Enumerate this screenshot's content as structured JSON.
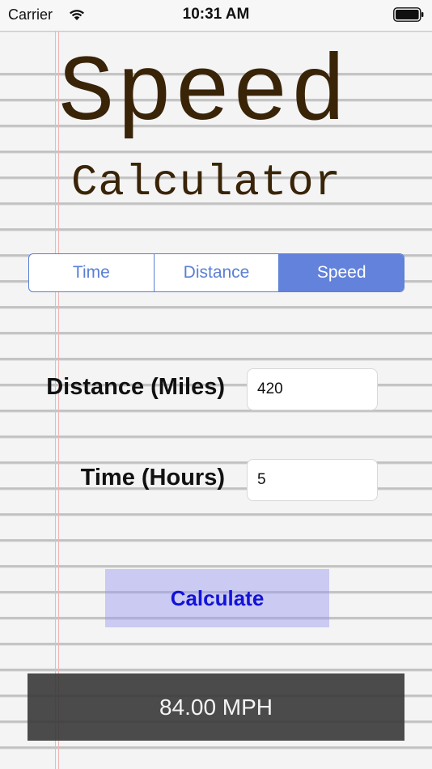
{
  "status_bar": {
    "carrier": "Carrier",
    "time": "10:31 AM",
    "wifi_icon": "wifi-icon",
    "battery_icon": "battery-icon"
  },
  "title": {
    "line1": "Speed",
    "line2": "Calculator"
  },
  "mode_selector": {
    "segments": [
      "Time",
      "Distance",
      "Speed"
    ],
    "selected": "Speed"
  },
  "fields": {
    "distance": {
      "label": "Distance (Miles)",
      "value": "420"
    },
    "time": {
      "label": "Time (Hours)",
      "value": "5"
    }
  },
  "calculate_label": "Calculate",
  "result": "84.00 MPH",
  "colors": {
    "title": "#3a2408",
    "accent": "#6282dc",
    "button_text": "#1212d8",
    "result_bg": "#3c3c3c"
  }
}
